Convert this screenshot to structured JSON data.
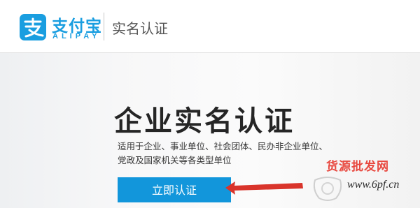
{
  "header": {
    "logo_cn": "支付宝",
    "logo_en": "ALIPAY",
    "title": "实名认证"
  },
  "hero": {
    "title": "企业实名认证",
    "description_line1": "适用于企业、事业单位、社会团体、民办非企业单位、",
    "description_line2": "党政及国家机关等各类型单位",
    "button_label": "立即认证"
  },
  "watermark": {
    "main": "货源批发网",
    "url": "www.6pf.cn"
  },
  "colors": {
    "brand_blue": "#1a9ee0",
    "button_blue": "#1296db",
    "arrow_red": "#d9342b"
  },
  "icons": {
    "logo": "alipay-zhi-icon",
    "arrow": "red-arrow-icon"
  }
}
